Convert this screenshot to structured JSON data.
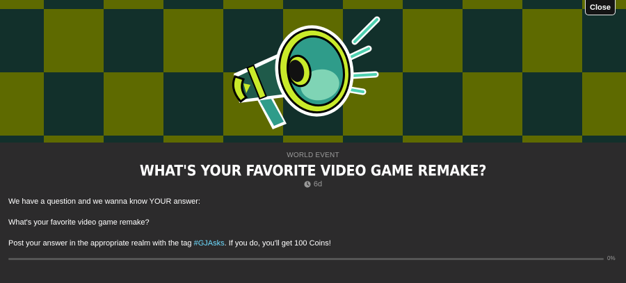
{
  "close_label": "Close",
  "event": {
    "kind": "WORLD EVENT",
    "title": "WHAT'S YOUR FAVORITE VIDEO GAME REMAKE?",
    "time_ago": "6d",
    "line1": "We have a question and we wanna know YOUR answer:",
    "line2": "What's your favorite video game remake?",
    "line3_before": "Post your answer in the appropriate realm with the tag ",
    "tag": "#GJAsks",
    "line3_after": ". If you do, you'll get 100 Coins!",
    "progress_label": "0%",
    "progress_value": 0
  },
  "icons": {
    "banner": "megaphone-icon",
    "time": "clock-icon"
  },
  "colors": {
    "checker_dark": "#12302b",
    "checker_light": "#5e6a00",
    "panel": "#2c2b2c",
    "link": "#6ddcff"
  }
}
